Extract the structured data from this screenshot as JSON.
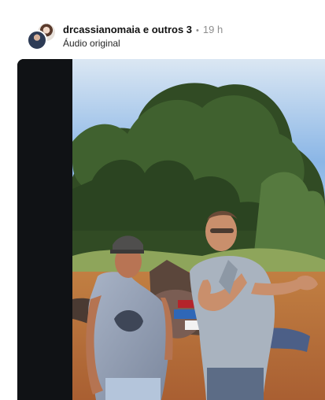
{
  "post": {
    "author": "drcassianomaia e outros 3",
    "separator": "•",
    "time_ago": "19 h",
    "audio_label": "Áudio original"
  },
  "colors": {
    "sky": "#8ab6e6",
    "ground": "#b8743e",
    "tree": "#2f4a24",
    "frame": "#0f1113"
  },
  "icons": [
    "avatar-stack"
  ],
  "media": {
    "type": "video-frame"
  }
}
